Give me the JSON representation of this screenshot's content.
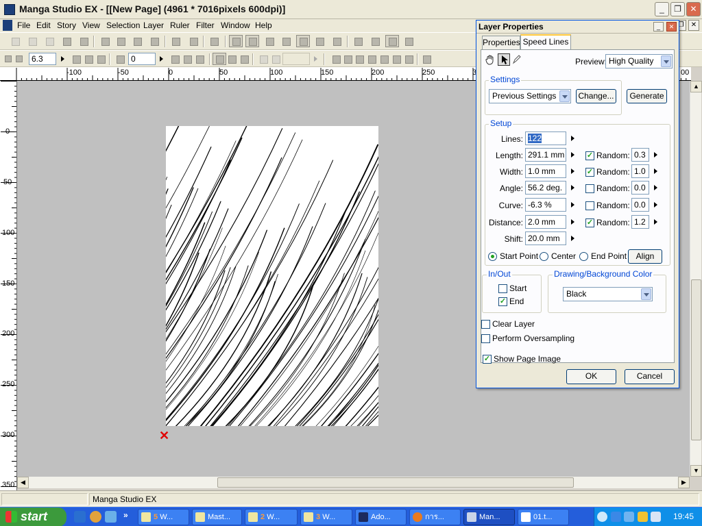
{
  "window": {
    "title": "Manga Studio EX - [[New Page] (4961 * 7016pixels 600dpi)]"
  },
  "menu": [
    "File",
    "Edit",
    "Story",
    "View",
    "Selection",
    "Layer",
    "Ruler",
    "Filter",
    "Window",
    "Help"
  ],
  "toolbar2": {
    "zoom_value": "6.3",
    "rotate_value": "0"
  },
  "rulers": {
    "horizontal": [
      "-100",
      "-50",
      "0",
      "50",
      "100",
      "150",
      "200",
      "250",
      "3",
      "00"
    ],
    "vertical": [
      "0",
      "50",
      "100",
      "150",
      "200",
      "250",
      "300",
      "350"
    ]
  },
  "status": {
    "app_name": "Manga Studio EX"
  },
  "taskbar": {
    "start_label": "start",
    "tasks": [
      {
        "count": "5",
        "label": "W..."
      },
      {
        "count": "",
        "label": "Mast..."
      },
      {
        "count": "2",
        "label": "W..."
      },
      {
        "count": "3",
        "label": "W..."
      },
      {
        "count": "",
        "label": "Ado..."
      },
      {
        "count": "",
        "label": "การ..."
      },
      {
        "count": "",
        "label": "Man..."
      },
      {
        "count": "",
        "label": "01.t..."
      }
    ],
    "clock": "19:45"
  },
  "dialog": {
    "title": "Layer Properties",
    "tabs": [
      "Properties",
      "Speed Lines"
    ],
    "preview_label": "Preview:",
    "preview_value": "High Quality",
    "settings": {
      "group_label": "Settings",
      "preset_value": "Previous Settings",
      "change_label": "Change...",
      "generate_label": "Generate"
    },
    "setup": {
      "group_label": "Setup",
      "lines_label": "Lines:",
      "lines_value": "122",
      "length_label": "Length:",
      "length_value": "291.1 mm",
      "length_random_checked": true,
      "length_random_value": "0.3",
      "width_label": "Width:",
      "width_value": "1.0 mm",
      "width_random_checked": true,
      "width_random_value": "1.0",
      "angle_label": "Angle:",
      "angle_value": "56.2 deg.",
      "angle_random_checked": false,
      "angle_random_value": "0.0",
      "curve_label": "Curve:",
      "curve_value": "-6.3 %",
      "curve_random_checked": false,
      "curve_random_value": "0.0",
      "distance_label": "Distance:",
      "distance_value": "2.0 mm",
      "distance_random_checked": true,
      "distance_random_value": "1.2",
      "shift_label": "Shift:",
      "shift_value": "20.0 mm",
      "random_label": "Random:",
      "start_point_label": "Start Point",
      "center_label": "Center",
      "end_point_label": "End Point",
      "selected_point": "Start Point",
      "align_label": "Align"
    },
    "inout": {
      "group_label": "In/Out",
      "start_label": "Start",
      "start_checked": false,
      "end_label": "End",
      "end_checked": true
    },
    "color": {
      "group_label": "Drawing/Background Color",
      "value": "Black"
    },
    "clear_layer_label": "Clear Layer",
    "clear_layer_checked": false,
    "oversampling_label": "Perform Oversampling",
    "oversampling_checked": false,
    "show_page_label": "Show Page Image",
    "show_page_checked": true,
    "ok_label": "OK",
    "cancel_label": "Cancel"
  },
  "colors": {
    "canvas_bg": "#c0c0c0",
    "xp_blue": "#245edb",
    "dialog_group": "#0046d5",
    "check_green": "#21a121",
    "cross_red": "#e00000"
  }
}
